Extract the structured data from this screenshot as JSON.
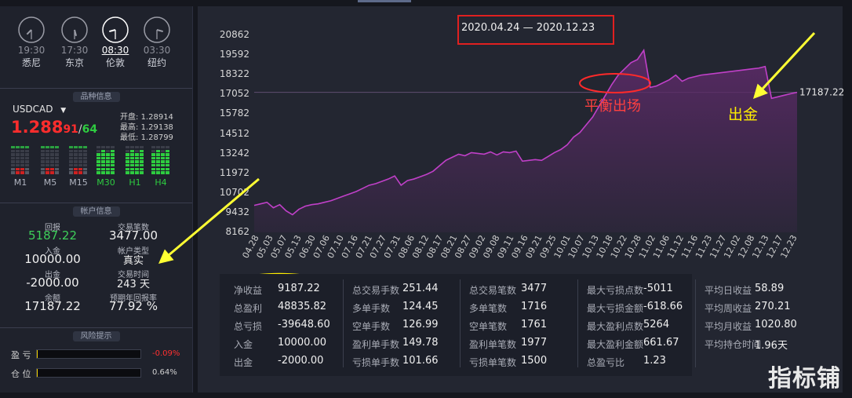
{
  "clocks": [
    {
      "time": "19:30",
      "city": "悉尼",
      "active": false
    },
    {
      "time": "17:30",
      "city": "东京",
      "active": false
    },
    {
      "time": "08:30",
      "city": "伦敦",
      "active": true
    },
    {
      "time": "03:30",
      "city": "纽约",
      "active": false
    }
  ],
  "product": {
    "section_title": "品种信息",
    "symbol": "USDCAD",
    "price_main": "1.288",
    "price_small": "91",
    "price_slash": "/",
    "price_ask": "64",
    "open_label": "开盘:",
    "open": "1.28914",
    "high_label": "最高:",
    "high": "1.29138",
    "low_label": "最低:",
    "low": "1.28799",
    "timeframes": [
      "M1",
      "M5",
      "M15",
      "M30",
      "H1",
      "H4"
    ]
  },
  "account": {
    "section_title": "帐户信息",
    "return_label": "回报",
    "return": "5187.22",
    "deposit_label": "入金",
    "deposit": "10000.00",
    "withdraw_label": "出金",
    "withdraw": "-2000.00",
    "balance_label": "余额",
    "balance": "17187.22",
    "trades_label": "交易笔数",
    "trades": "3477.00",
    "type_label": "帐户类型",
    "type": "真实",
    "time_label": "交易时间",
    "time": "243 天",
    "annual_label": "预期年回报率",
    "annual": "77.92 %"
  },
  "risk": {
    "section_title": "风险提示",
    "pl_label": "盈 亏",
    "pl_value": "-0.09%",
    "pl_fill": 0.0009,
    "pos_label": "仓 位",
    "pos_value": "0.64%",
    "pos_fill": 0.0064
  },
  "chart_data": {
    "type": "area",
    "title": "2020.04.24 — 2020.12.23",
    "y_ticks": [
      "20862",
      "19592",
      "18322",
      "17052",
      "15782",
      "14512",
      "13242",
      "11972",
      "10702",
      "9432",
      "8162"
    ],
    "ylim": [
      8162,
      20862
    ],
    "x_ticks": [
      "04.28",
      "05.03",
      "05.07",
      "05.13",
      "06.30",
      "07.06",
      "07.10",
      "07.16",
      "07.21",
      "07.27",
      "07.31",
      "08.06",
      "08.12",
      "08.17",
      "08.21",
      "08.27",
      "09.02",
      "09.08",
      "09.11",
      "09.16",
      "09.21",
      "09.25",
      "10.01",
      "10.07",
      "10.13",
      "10.18",
      "10.22",
      "10.28",
      "11.02",
      "11.06",
      "11.12",
      "11.16",
      "11.23",
      "11.27",
      "12.02",
      "12.08",
      "12.13",
      "12.17",
      "12.23"
    ],
    "values": [
      9900,
      10000,
      10100,
      9750,
      9950,
      9550,
      9300,
      9650,
      9850,
      9950,
      10000,
      10100,
      10200,
      10350,
      10500,
      10650,
      10800,
      11000,
      11200,
      11300,
      11450,
      11600,
      11800,
      11200,
      11500,
      11600,
      11750,
      11900,
      12100,
      12450,
      12800,
      13000,
      13200,
      13100,
      13300,
      13250,
      13200,
      13350,
      13150,
      13350,
      13300,
      13400,
      12750,
      12800,
      12850,
      12800,
      13050,
      13300,
      13500,
      13800,
      14300,
      14600,
      15100,
      15600,
      16300,
      17000,
      17700,
      18300,
      18700,
      19100,
      19300,
      19900,
      17500,
      17600,
      17800,
      18000,
      18300,
      17900,
      18100,
      18200,
      18300,
      18350,
      18400,
      18450,
      18500,
      18550,
      18600,
      18650,
      18700,
      18750,
      18850,
      16800,
      16900,
      17000,
      17100,
      17187
    ],
    "current_label": "17187.22",
    "current": 17187.22,
    "annotations": [
      {
        "text": "平衡出场",
        "color": "#ff4040"
      },
      {
        "text": "出金",
        "color": "#ffee00"
      }
    ],
    "line_color": "#c040c8",
    "fill_color": "#5a2a66"
  },
  "stats": [
    [
      {
        "k": "净收益",
        "v": "9187.22"
      },
      {
        "k": "总盈利",
        "v": "48835.82"
      },
      {
        "k": "总亏损",
        "v": "-39648.60"
      },
      {
        "k": "入金",
        "v": "10000.00"
      },
      {
        "k": "出金",
        "v": "-2000.00"
      }
    ],
    [
      {
        "k": "总交易手数",
        "v": "251.44"
      },
      {
        "k": "多单手数",
        "v": "124.45"
      },
      {
        "k": "空单手数",
        "v": "126.99"
      },
      {
        "k": "盈利单手数",
        "v": "149.78"
      },
      {
        "k": "亏损单手数",
        "v": "101.66"
      }
    ],
    [
      {
        "k": "总交易笔数",
        "v": "3477"
      },
      {
        "k": "多单笔数",
        "v": "1716"
      },
      {
        "k": "空单笔数",
        "v": "1761"
      },
      {
        "k": "盈利单笔数",
        "v": "1977"
      },
      {
        "k": "亏损单笔数",
        "v": "1500"
      }
    ],
    [
      {
        "k": "最大亏损点数",
        "v": "-5011"
      },
      {
        "k": "最大亏损金额",
        "v": "-618.66"
      },
      {
        "k": "最大盈利点数",
        "v": "5264"
      },
      {
        "k": "最大盈利金额",
        "v": "661.67"
      },
      {
        "k": "总盈亏比",
        "v": "1.23"
      }
    ],
    [
      {
        "k": "平均日收益",
        "v": "58.89"
      },
      {
        "k": "平均周收益",
        "v": "270.21"
      },
      {
        "k": "平均月收益",
        "v": "1020.80"
      },
      {
        "k": "平均持仓时间",
        "v": "1.96天"
      }
    ]
  ],
  "watermark": "指标铺"
}
